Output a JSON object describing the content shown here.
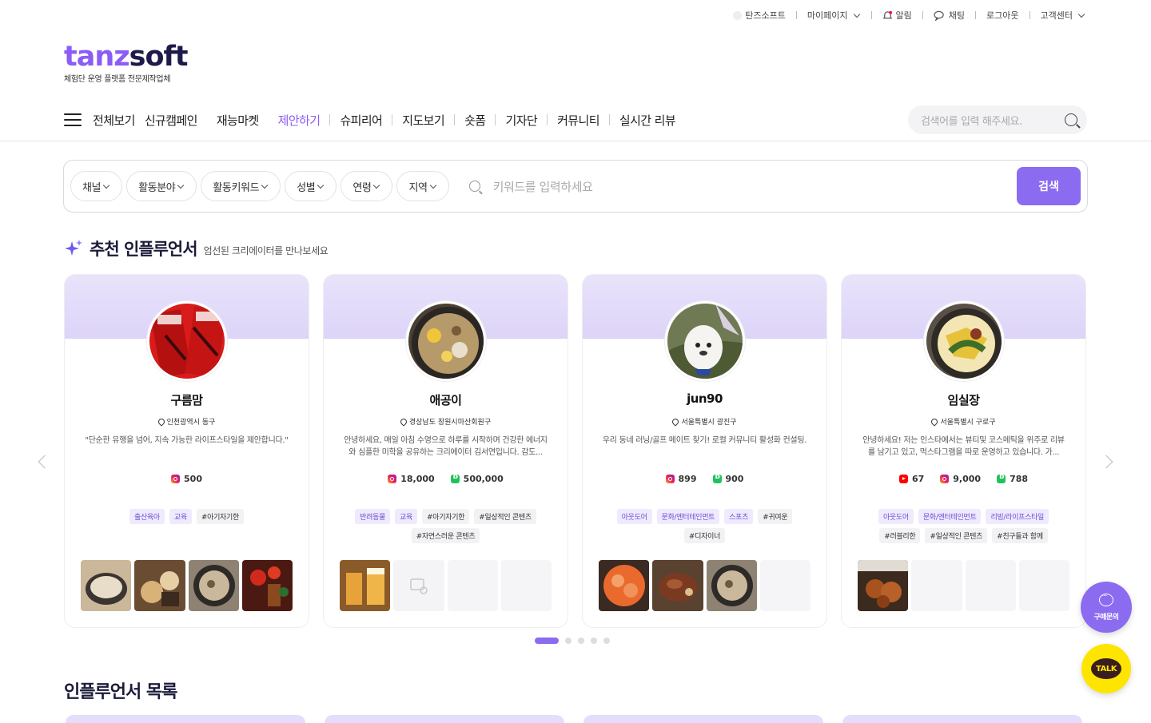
{
  "topbar": {
    "items": [
      {
        "label": "탄즈소프트",
        "icon": "brand-dot-icon"
      },
      {
        "label": "마이페이지",
        "icon": "chevron-down-icon"
      },
      {
        "label": "알림",
        "icon": "bell-icon"
      },
      {
        "label": "채팅",
        "icon": "chat-icon"
      },
      {
        "label": "로그아웃"
      },
      {
        "label": "고객센터",
        "icon": "chevron-down-icon"
      }
    ]
  },
  "logo": {
    "part1": "tanz",
    "part2": "soft",
    "sub": "체험단 운영 플랫폼 전문제작업체"
  },
  "gnb": {
    "items": [
      "전체보기",
      "신규캠페인",
      "재능마켓",
      "제안하기",
      "슈피리어",
      "지도보기",
      "숏폼",
      "기자단",
      "커뮤니티",
      "실시간 리뷰"
    ],
    "active_index": 3,
    "search_placeholder": "검색어를 입력 해주세요."
  },
  "filter": {
    "buttons": [
      "채널",
      "활동분야",
      "활동키워드",
      "성별",
      "연령",
      "지역"
    ],
    "keyword_placeholder": "키워드를 입력하세요",
    "search_label": "검색"
  },
  "recommend": {
    "title": "추천 인플루언서",
    "subtitle": "엄선된 크리에이터를 만나보세요",
    "cards": [
      {
        "name": "구름맘",
        "location": "인천광역시 동구",
        "desc": "\"단순한 유행을 넘어, 지속 가능한 라이프스타일을 제안합니다.\"",
        "stats": [
          {
            "type": "instagram",
            "value": "500"
          }
        ],
        "categories": [
          "출산육아",
          "교육"
        ],
        "keywords": [
          "#아기자기한"
        ],
        "thumbs": [
          "food",
          "food2",
          "food3",
          "drink"
        ]
      },
      {
        "name": "애공이",
        "location": "경상남도 창원시마산회원구",
        "desc": "안녕하세요, 매일 아침 수영으로 하루를 시작하며 건강한 에너지와 심플한 미학을 공유하는 크리에이터 김서연입니다. 감도...",
        "stats": [
          {
            "type": "instagram",
            "value": "18,000"
          },
          {
            "type": "blog",
            "value": "500,000"
          }
        ],
        "categories": [
          "반려동물",
          "교육"
        ],
        "keywords": [
          "#아기자기한",
          "#일상적인 콘텐츠",
          "#자연스러운 콘텐츠"
        ],
        "thumbs": [
          "beer",
          "empty-image",
          "empty",
          "empty"
        ]
      },
      {
        "name": "jun90",
        "location": "서울특별시 광진구",
        "desc": "우리 동네 러닝/골프 메이트 찾기! 로컬 커뮤니티 활성화 컨설팅.",
        "stats": [
          {
            "type": "instagram",
            "value": "899"
          },
          {
            "type": "blog",
            "value": "900"
          }
        ],
        "categories": [
          "아웃도어",
          "문화/엔터테인먼트",
          "스포츠"
        ],
        "keywords": [
          "#귀여운",
          "#디자이너"
        ],
        "thumbs": [
          "salmon",
          "steak",
          "food3",
          "empty"
        ]
      },
      {
        "name": "임실장",
        "location": "서울특별시 구로구",
        "desc": "안녕하세요! 저는 인스타에서는 뷰티및 코스메틱을 위주로 리뷰를 남기고 있고, 먹스타그램을 따로 운영하고 있습니다. 가...",
        "stats": [
          {
            "type": "youtube",
            "value": "67"
          },
          {
            "type": "instagram",
            "value": "9,000"
          },
          {
            "type": "blog",
            "value": "788"
          }
        ],
        "categories": [
          "아웃도어",
          "문화/엔터테인먼트",
          "리빙/라이프스타일"
        ],
        "keywords": [
          "#러블리한",
          "#일상적인 콘텐츠",
          "#친구들과 함께"
        ],
        "thumbs": [
          "chicken",
          "empty",
          "empty",
          "empty"
        ]
      }
    ]
  },
  "pagination": {
    "count": 5,
    "active": 0
  },
  "list": {
    "title": "인플루언서 목록"
  },
  "fab": {
    "ask_label": "구매문의",
    "talk_label": "TALK"
  },
  "colors": {
    "accent": "#8b6cf0",
    "brand_purple": "#8b5cf6",
    "brand_navy": "#1e1b4b",
    "kakao": "#fee500"
  }
}
